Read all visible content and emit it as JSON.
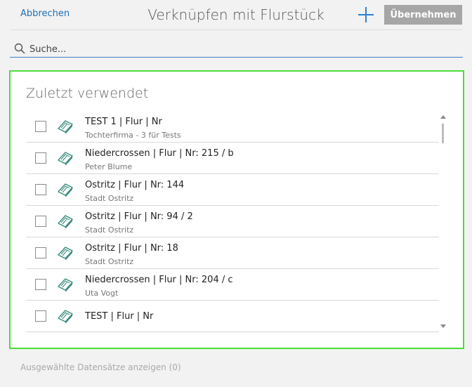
{
  "header": {
    "cancel_label": "Abbrechen",
    "title": "Verknüpfen mit Flurstück",
    "add_icon": "plus-icon",
    "accept_label": "Übernehmen"
  },
  "search": {
    "placeholder": "Suche...",
    "value": "",
    "icon": "search-icon"
  },
  "recent": {
    "title": "Zuletzt verwendet",
    "items": [
      {
        "title": "TEST 1 | Flur | Nr",
        "subtitle": "Tochterfirma - 3 für Tests",
        "checked": false,
        "icon": "parcel-icon"
      },
      {
        "title": "Niedercrossen | Flur | Nr: 215 / b",
        "subtitle": "Peter Blume",
        "checked": false,
        "icon": "parcel-icon"
      },
      {
        "title": "Ostritz | Flur | Nr: 144",
        "subtitle": "Stadt Ostritz",
        "checked": false,
        "icon": "parcel-icon"
      },
      {
        "title": "Ostritz | Flur | Nr: 94 / 2",
        "subtitle": "Stadt Ostritz",
        "checked": false,
        "icon": "parcel-icon"
      },
      {
        "title": "Ostritz | Flur | Nr: 18",
        "subtitle": "Stadt Ostritz",
        "checked": false,
        "icon": "parcel-icon"
      },
      {
        "title": "Niedercrossen | Flur | Nr: 204 / c",
        "subtitle": "Uta Vogt",
        "checked": false,
        "icon": "parcel-icon"
      },
      {
        "title": "TEST | Flur | Nr",
        "subtitle": "",
        "checked": false,
        "icon": "parcel-icon"
      }
    ]
  },
  "footer": {
    "show_selected_label": "Ausgewählte Datensätze anzeigen (0)"
  },
  "colors": {
    "accent": "#1f6fb5",
    "panel_border": "#4ddc3a",
    "accept_button_bg": "#a6a6a6",
    "search_underline": "#3b7fc4",
    "icon_teal": "#3a8d7e"
  }
}
